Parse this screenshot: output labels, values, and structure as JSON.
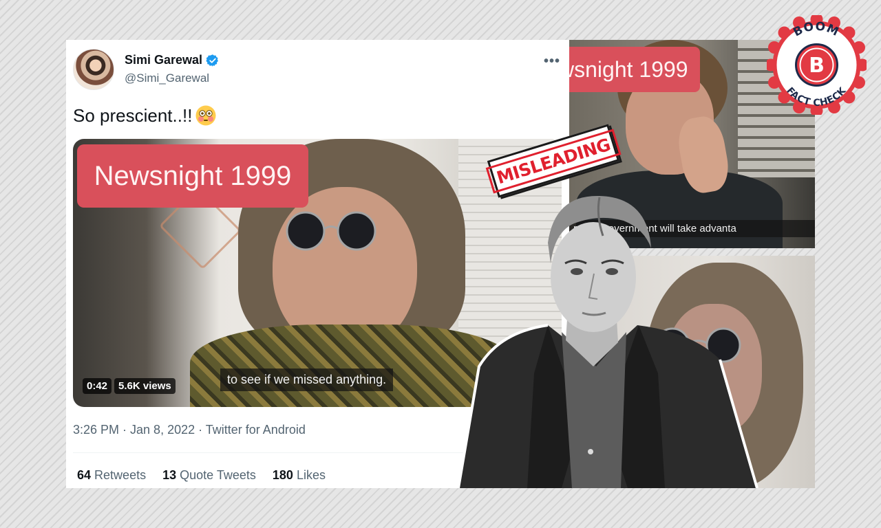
{
  "tweet": {
    "display_name": "Simi Garewal",
    "handle": "@Simi_Garewal",
    "text": "So prescient..!!",
    "emoji": "flushed-face-emoji",
    "media": {
      "label": "Newsnight 1999",
      "subtitle": "to see if we missed anything.",
      "duration": "0:42",
      "views": "5.6K views"
    },
    "timestamp": "3:26 PM · Jan 8, 2022 · Twitter for Android",
    "stats": {
      "retweets_count": "64",
      "retweets_label": "Retweets",
      "quote_count": "13",
      "quote_label": "Quote Tweets",
      "likes_count": "180",
      "likes_label": "Likes"
    }
  },
  "collage": {
    "top_frame_label": "wsnight 1999",
    "top_frame_subtitle": "r right government will take advanta"
  },
  "stamp": {
    "text": "MISLEADING"
  },
  "badge": {
    "top_text": "BOOM",
    "letter": "B",
    "bottom_text": "FACT CHECK"
  },
  "colors": {
    "verified": "#1d9bf0",
    "label_red": "#d9505b",
    "stamp_red": "#e0202e",
    "badge_red": "#e23a43"
  }
}
